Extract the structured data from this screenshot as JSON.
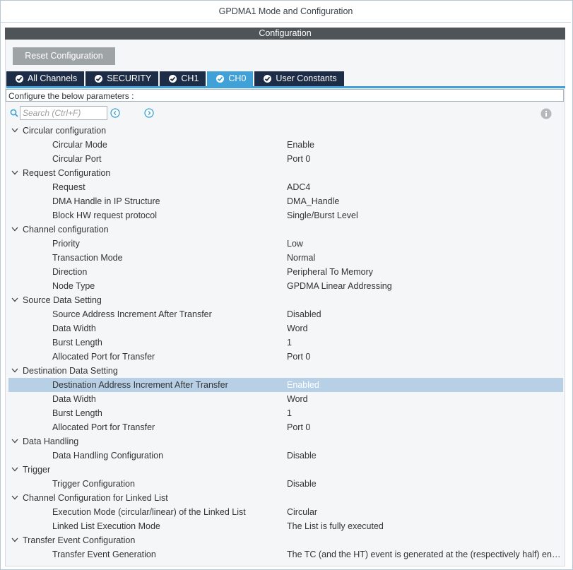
{
  "window": {
    "title": "GPDMA1 Mode and Configuration"
  },
  "config_bar": {
    "label": "Configuration"
  },
  "reset_button": {
    "label": "Reset Configuration"
  },
  "tabs": [
    {
      "label": "All Channels",
      "active": false
    },
    {
      "label": "SECURITY",
      "active": false
    },
    {
      "label": "CH1",
      "active": false
    },
    {
      "label": "CH0",
      "active": true
    },
    {
      "label": "User Constants",
      "active": false
    }
  ],
  "description": "Configure the below parameters :",
  "search": {
    "placeholder": "Search (Ctrl+F)"
  },
  "icons": {
    "search": "search-icon",
    "prev": "arrow-left-circle-icon",
    "next": "arrow-right-circle-icon",
    "info": "info-icon"
  },
  "colors": {
    "tab_bg": "#1d2d47",
    "tab_active": "#3fa1d8",
    "config_bar": "#4f5458",
    "selected_row": "#b8d0e6"
  },
  "groups": [
    {
      "name": "Circular configuration",
      "params": [
        {
          "name": "Circular Mode",
          "value": "Enable"
        },
        {
          "name": "Circular Port",
          "value": "Port 0"
        }
      ]
    },
    {
      "name": "Request Configuration",
      "params": [
        {
          "name": "Request",
          "value": "ADC4"
        },
        {
          "name": "DMA Handle in IP Structure",
          "value": "DMA_Handle"
        },
        {
          "name": "Block HW request protocol",
          "value": "Single/Burst Level"
        }
      ]
    },
    {
      "name": "Channel configuration",
      "params": [
        {
          "name": "Priority",
          "value": "Low"
        },
        {
          "name": "Transaction Mode",
          "value": "Normal"
        },
        {
          "name": "Direction",
          "value": "Peripheral To Memory"
        },
        {
          "name": "Node Type",
          "value": "GPDMA Linear Addressing"
        }
      ]
    },
    {
      "name": "Source Data Setting",
      "params": [
        {
          "name": "Source Address Increment After Transfer",
          "value": "Disabled"
        },
        {
          "name": "Data Width",
          "value": "Word"
        },
        {
          "name": "Burst Length",
          "value": "1"
        },
        {
          "name": "Allocated Port for Transfer",
          "value": "Port 0"
        }
      ]
    },
    {
      "name": "Destination Data Setting",
      "params": [
        {
          "name": "Destination Address Increment After Transfer",
          "value": "Enabled",
          "selected": true
        },
        {
          "name": "Data Width",
          "value": "Word"
        },
        {
          "name": "Burst Length",
          "value": "1"
        },
        {
          "name": "Allocated Port for Transfer",
          "value": "Port 0"
        }
      ]
    },
    {
      "name": "Data Handling",
      "params": [
        {
          "name": "Data Handling Configuration",
          "value": "Disable"
        }
      ]
    },
    {
      "name": "Trigger",
      "params": [
        {
          "name": "Trigger Configuration",
          "value": "Disable"
        }
      ]
    },
    {
      "name": "Channel Configuration for Linked List",
      "params": [
        {
          "name": "Execution Mode (circular/linear) of the Linked List",
          "value": "Circular"
        },
        {
          "name": "Linked List Execution Mode",
          "value": "The List is fully executed"
        }
      ]
    },
    {
      "name": "Transfer Event Configuration",
      "params": [
        {
          "name": "Transfer Event Generation",
          "value": "The TC (and the HT) event is generated at the (respectively half) end of each block"
        }
      ]
    }
  ]
}
